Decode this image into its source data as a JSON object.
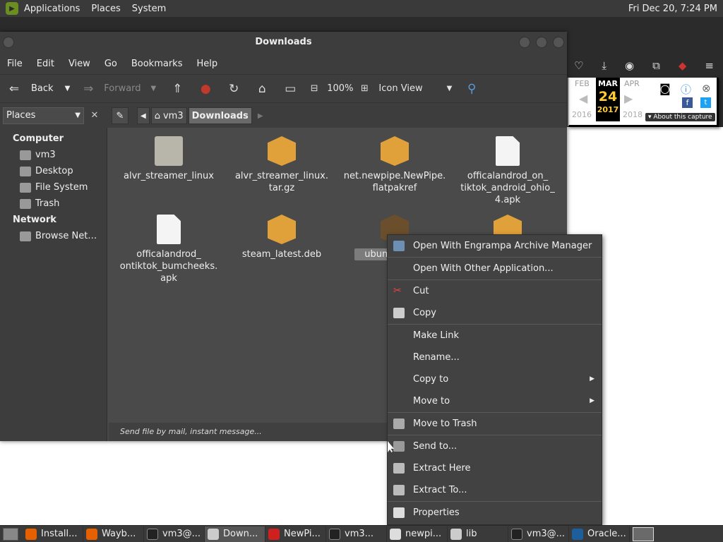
{
  "top_panel": {
    "menus": [
      "Applications",
      "Places",
      "System"
    ],
    "clock": "Fri Dec 20,  7:24 PM"
  },
  "wayback": {
    "prev_month": "FEB",
    "cur_month": "MAR",
    "next_month": "APR",
    "day": "24",
    "prev_year": "2016",
    "cur_year": "2017",
    "next_year": "2018",
    "about": "▾ About this capture"
  },
  "window": {
    "title": "Downloads",
    "menubar": [
      "File",
      "Edit",
      "View",
      "Go",
      "Bookmarks",
      "Help"
    ],
    "toolbar": {
      "back": "Back",
      "forward": "Forward",
      "zoom": "100%",
      "view_mode": "Icon View"
    },
    "location": {
      "places_label": "Places",
      "crumbs": [
        "vm3",
        "Downloads"
      ]
    },
    "sidebar": {
      "computer_header": "Computer",
      "computer_items": [
        "vm3",
        "Desktop",
        "File System",
        "Trash"
      ],
      "network_header": "Network",
      "network_items": [
        "Browse Net…"
      ]
    },
    "files": [
      {
        "name": "alvr_streamer_linux",
        "kind": "folder"
      },
      {
        "name": "alvr_streamer_linux.\ntar.gz",
        "kind": "archive"
      },
      {
        "name": "net.newpipe.NewPipe.\nflatpakref",
        "kind": "archive"
      },
      {
        "name": "officalandrod_on_\ntiktok_android_ohio_\n4.apk",
        "kind": "document"
      },
      {
        "name": "officalandrod_\nontiktok_bumcheeks.\napk",
        "kind": "document"
      },
      {
        "name": "steam_latest.deb",
        "kind": "archive"
      },
      {
        "name": "ubuntu\nvmw",
        "kind": "archive-selected"
      },
      {
        "name": "",
        "kind": "archive"
      }
    ],
    "status": "Send file by mail, instant message..."
  },
  "context_menu": {
    "items": [
      {
        "label": "Open With Engrampa Archive Manager",
        "icon": "archive-manager-icon"
      },
      {
        "label": "Open With Other Application...",
        "icon": ""
      },
      {
        "label": "Cut",
        "icon": "scissors-icon"
      },
      {
        "label": "Copy",
        "icon": "copy-icon"
      },
      {
        "label": "Make Link",
        "icon": ""
      },
      {
        "label": "Rename...",
        "icon": ""
      },
      {
        "label": "Copy to",
        "icon": "",
        "submenu": true
      },
      {
        "label": "Move to",
        "icon": "",
        "submenu": true
      },
      {
        "label": "Move to Trash",
        "icon": "trash-icon"
      },
      {
        "label": "Send to...",
        "icon": "send-icon"
      },
      {
        "label": "Extract Here",
        "icon": "extract-icon"
      },
      {
        "label": "Extract To...",
        "icon": "extract-to-icon"
      },
      {
        "label": "Properties",
        "icon": "properties-icon"
      }
    ]
  },
  "taskbar": {
    "tasks": [
      "Install...",
      "Wayb...",
      "vm3@...",
      "Down...",
      "NewPi...",
      "vm3...",
      "newpi...",
      "lib",
      "vm3@...",
      "Oracle..."
    ]
  }
}
